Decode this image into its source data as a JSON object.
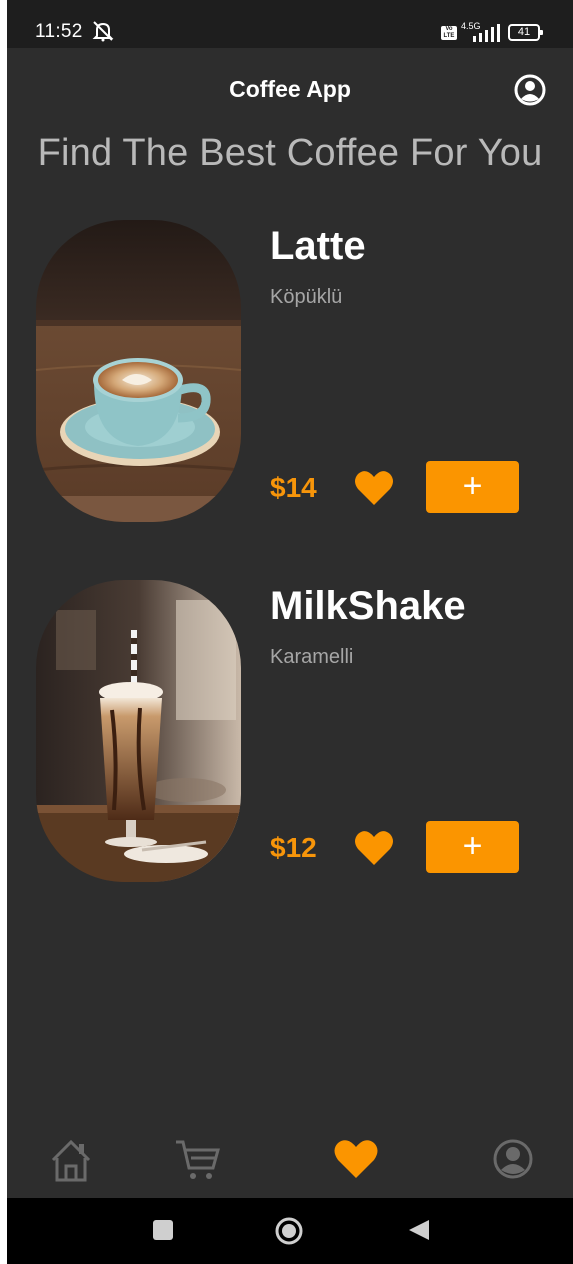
{
  "status_bar": {
    "time": "11:52",
    "network": "4.5G",
    "volte": "Vo LTE",
    "battery": "41",
    "icons": [
      "mute-icon",
      "volte-icon",
      "signal-icon",
      "battery-icon"
    ]
  },
  "header": {
    "title": "Coffee App",
    "profile_icon": "profile-icon"
  },
  "heading": "Find The Best Coffee For You",
  "products": [
    {
      "name": "Latte",
      "subtitle": "Köpüklü",
      "price": "$14",
      "add_label": "+",
      "favorite": true,
      "image": "latte-cup-photo"
    },
    {
      "name": "MilkShake",
      "subtitle": "Karamelli",
      "price": "$12",
      "add_label": "+",
      "favorite": true,
      "image": "milkshake-glass-photo"
    }
  ],
  "bottom_nav": {
    "items": [
      {
        "icon": "home-icon",
        "active": false
      },
      {
        "icon": "cart-icon",
        "active": false
      },
      {
        "icon": "heart-icon",
        "active": true
      },
      {
        "icon": "profile-icon",
        "active": false
      }
    ]
  },
  "colors": {
    "background": "#2d2d2d",
    "accent": "#fb9500",
    "price": "#f7950a",
    "inactive_icon": "#6a6a6a",
    "heading": "#b9b9b9",
    "subtitle": "#a6a6a6"
  }
}
